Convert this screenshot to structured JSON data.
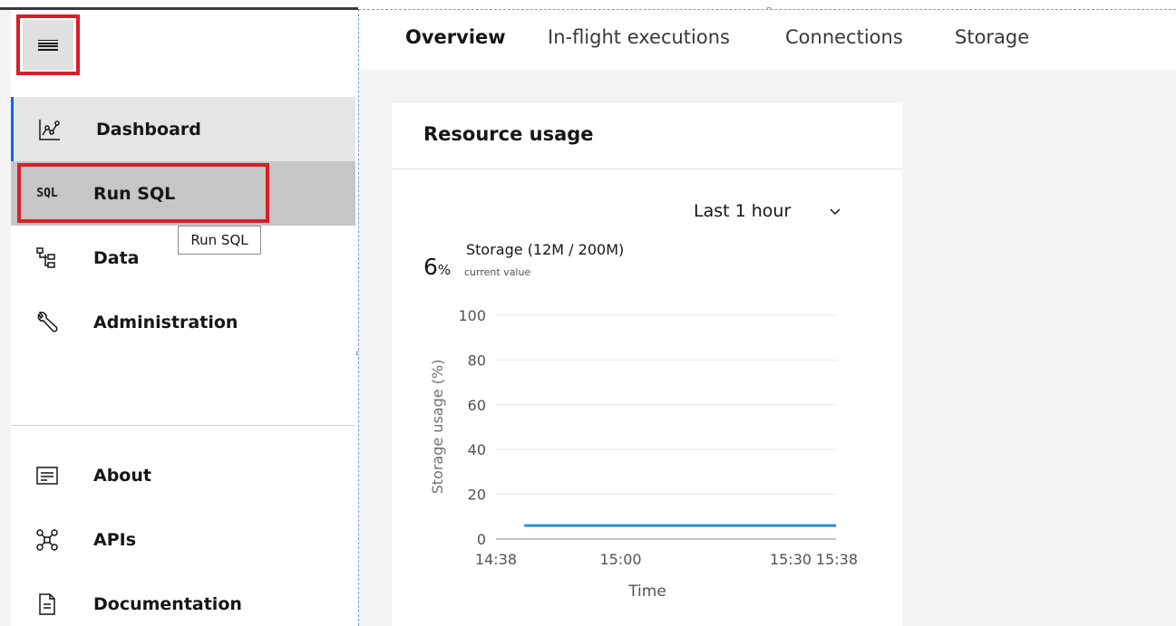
{
  "sidebar": {
    "items": [
      {
        "label": "Dashboard",
        "icon": "dashboard-chart-icon"
      },
      {
        "label": "Run SQL",
        "icon": "sql-icon",
        "icon_text": "SQL"
      },
      {
        "label": "Data",
        "icon": "data-tree-icon"
      },
      {
        "label": "Administration",
        "icon": "wrench-icon"
      }
    ],
    "bottom_items": [
      {
        "label": "About",
        "icon": "document-list-icon"
      },
      {
        "label": "APIs",
        "icon": "api-network-icon"
      },
      {
        "label": "Documentation",
        "icon": "document-icon"
      }
    ],
    "tooltip": "Run SQL"
  },
  "tabs": [
    {
      "label": "Overview",
      "active": true
    },
    {
      "label": "In-flight executions",
      "active": false
    },
    {
      "label": "Connections",
      "active": false
    },
    {
      "label": "Storage",
      "active": false
    }
  ],
  "card": {
    "title": "Resource usage",
    "time_range": "Last 1 hour",
    "metric": {
      "value": "6",
      "unit": "%",
      "name": "Storage (12M / 200M)",
      "caption": "current value"
    }
  },
  "colors": {
    "accent_blue": "#0f62fe",
    "series_line": "#2a8fd6",
    "highlight_red": "#da1e28"
  },
  "chart_data": {
    "type": "line",
    "xlabel": "Time",
    "ylabel": "Storage usage (%)",
    "ylim": [
      0,
      100
    ],
    "yticks": [
      0,
      20,
      40,
      60,
      80,
      100
    ],
    "xticks": [
      "14:38",
      "15:00",
      "15:30",
      "15:38"
    ],
    "xlim_minutes": [
      0,
      60
    ],
    "xtick_minutes": [
      0,
      22,
      52,
      60
    ],
    "grid": true,
    "series": [
      {
        "x_minutes": [
          5,
          60
        ],
        "values": [
          6,
          6
        ]
      }
    ]
  }
}
